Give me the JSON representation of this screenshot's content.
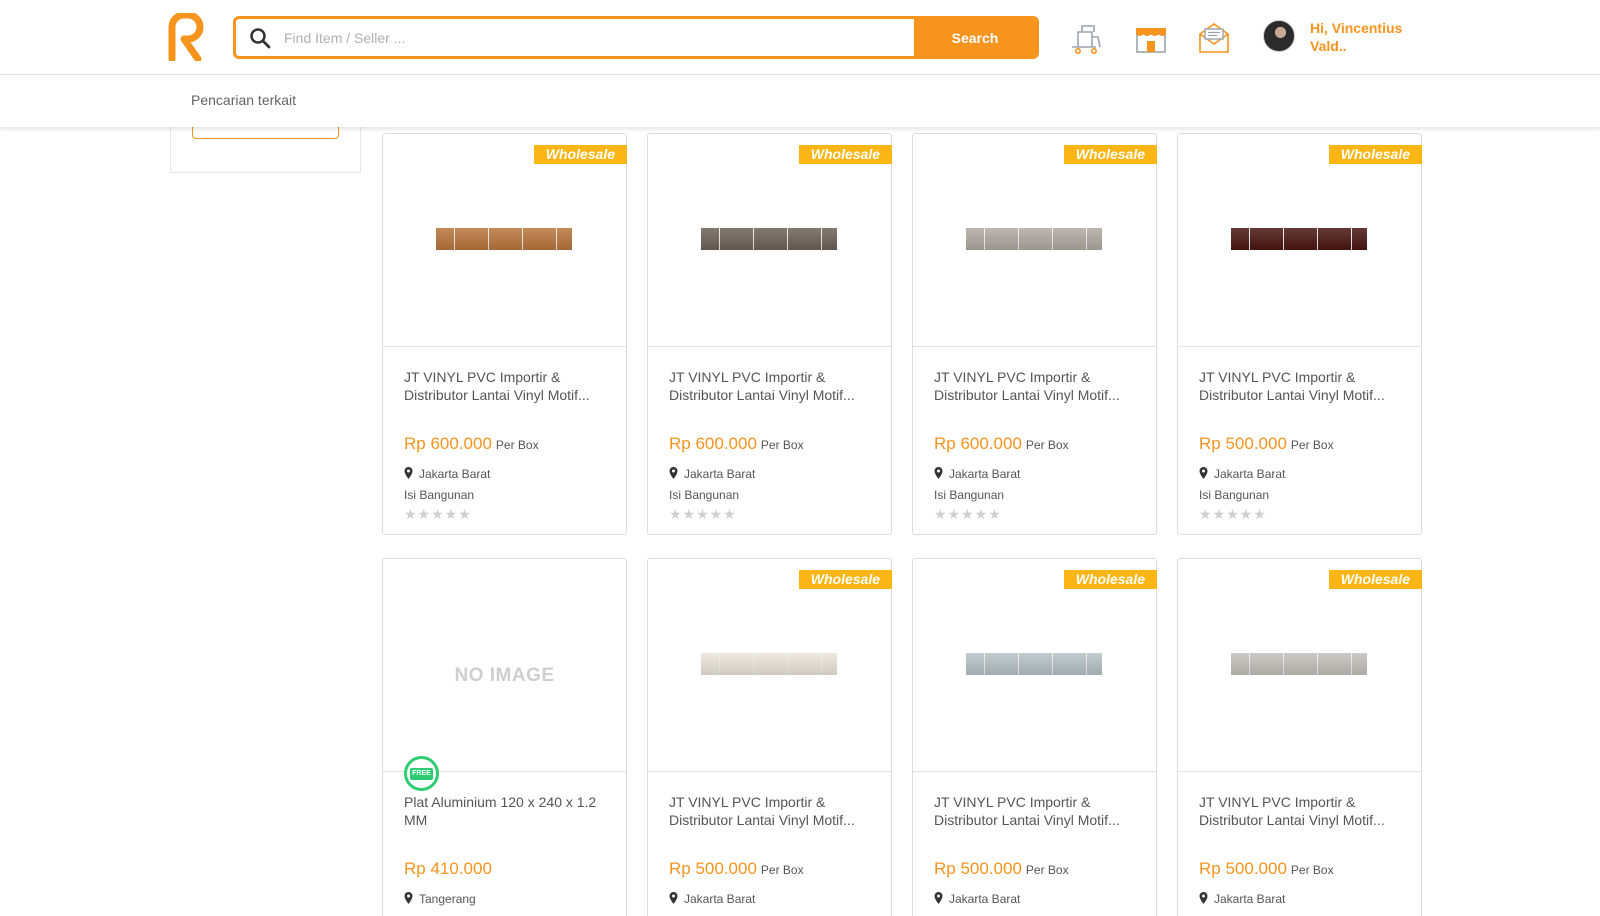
{
  "header": {
    "search_placeholder": "Find Item / Seller ...",
    "search_button": "Search",
    "greeting": "Hi, Vincentius Vald..",
    "icons": [
      "cart-icon",
      "store-icon",
      "mail-icon"
    ],
    "accent_color": "#f7941d"
  },
  "subbar": {
    "related_label": "Pencarian terkait"
  },
  "products": [
    {
      "badge": "Wholesale",
      "image": "swatch-oak-brown",
      "title": "JT VINYL PVC Importir & Distributor Lantai Vinyl Motif...",
      "price": "Rp 600.000",
      "unit": "Per Box",
      "location": "Jakarta Barat",
      "seller": "Isi Bangunan",
      "stars": "★★★★★",
      "color": "#b9763c"
    },
    {
      "badge": "Wholesale",
      "image": "swatch-dark-grey",
      "title": "JT VINYL PVC Importir & Distributor Lantai Vinyl Motif...",
      "price": "Rp 600.000",
      "unit": "Per Box",
      "location": "Jakarta Barat",
      "seller": "Isi Bangunan",
      "stars": "★★★★★",
      "color": "#6e6258"
    },
    {
      "badge": "Wholesale",
      "image": "swatch-light-grey",
      "title": "JT VINYL PVC Importir & Distributor Lantai Vinyl Motif...",
      "price": "Rp 600.000",
      "unit": "Per Box",
      "location": "Jakarta Barat",
      "seller": "Isi Bangunan",
      "stars": "★★★★★",
      "color": "#b0aba2"
    },
    {
      "badge": "Wholesale",
      "image": "swatch-mahogany",
      "title": "JT VINYL PVC Importir & Distributor Lantai Vinyl Motif...",
      "price": "Rp 500.000",
      "unit": "Per Box",
      "location": "Jakarta Barat",
      "seller": "Isi Bangunan",
      "stars": "★★★★★",
      "color": "#4a1712"
    },
    {
      "badge": "",
      "image": "no-image",
      "no_image_text": "NO IMAGE",
      "free_label": "FREE",
      "title": "Plat Aluminium 120 x 240 x 1.2 MM",
      "price": "Rp 410.000",
      "unit": "",
      "location": "Tangerang",
      "seller": "",
      "stars": "",
      "color": ""
    },
    {
      "badge": "Wholesale",
      "image": "swatch-cream",
      "title": "JT VINYL PVC Importir & Distributor Lantai Vinyl Motif...",
      "price": "Rp 500.000",
      "unit": "Per Box",
      "location": "Jakarta Barat",
      "seller": "",
      "stars": "",
      "color": "#ece6da"
    },
    {
      "badge": "Wholesale",
      "image": "swatch-blue-grey",
      "title": "JT VINYL PVC Importir & Distributor Lantai Vinyl Motif...",
      "price": "Rp 500.000",
      "unit": "Per Box",
      "location": "Jakarta Barat",
      "seller": "",
      "stars": "",
      "color": "#b8c3c7"
    },
    {
      "badge": "Wholesale",
      "image": "swatch-grey-stripe",
      "title": "JT VINYL PVC Importir & Distributor Lantai Vinyl Motif...",
      "price": "Rp 500.000",
      "unit": "Per Box",
      "location": "Jakarta Barat",
      "seller": "",
      "stars": "",
      "color": "#c4c1bc"
    }
  ]
}
